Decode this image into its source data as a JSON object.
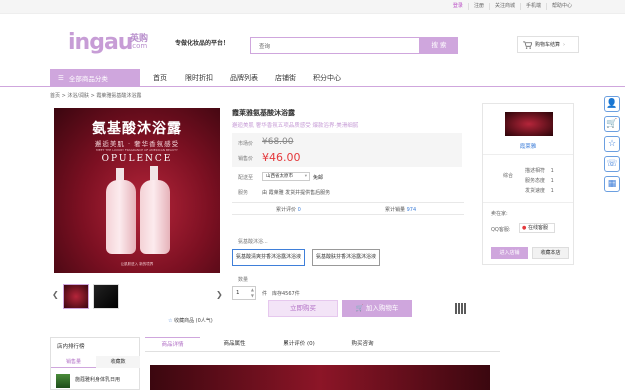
{
  "topbar": {
    "links": [
      "登录",
      "注册",
      "关注商城",
      "手机端",
      "帮助中心"
    ]
  },
  "header": {
    "logo": "ingau",
    "logo_cn": "英购",
    "logo_com": ".com",
    "slogan": "专做化妆品的平台！",
    "search_placeholder": "查询",
    "search_button": "搜 索",
    "cart_label": "购物车结算"
  },
  "nav": {
    "category_button": "全部商品分类",
    "items": [
      "首页",
      "限时折扣",
      "品牌列表",
      "店铺街",
      "积分中心"
    ]
  },
  "breadcrumb": "首页 > 沐浴/润肤 > 霞莱雅氨基酸沐浴露",
  "gallery": {
    "image_title": "氨基酸沐浴露",
    "image_tagline": "邂逅美肌 · 奢华香氛感受",
    "image_small": "MEET THE LUXURY FRAGRANCE OF AMERICAN BEAUTY",
    "image_brand": "OPULENCE",
    "image_footer": "让肌肤进入 新的境界",
    "favorite": "收藏商品 (0人气)"
  },
  "product": {
    "title": "霞莱雅氨基酸沐浴露",
    "subtitle": "邂逅美肌 奢华香氛五项品质感受 爆款浴界·美滑细腻",
    "orig_label": "市场价",
    "orig_price": "¥68.00",
    "sale_label": "销售价",
    "sale_price": "¥46.00",
    "ship_label": "配送至",
    "ship_region": "山西省太原市",
    "ship_fee": "免邮",
    "service_label": "服务",
    "service_text": "由 霞莱雅 发货并提供售后服务",
    "review_label": "累计评价",
    "review_count": "0",
    "sales_label": "累计销量",
    "sales_count": "974",
    "option_hint": "氨基酸沐浴...",
    "options": [
      "氨基酸清爽芬香沐浴露沐浴液",
      "氨基酸肤芬香沐浴露沐浴液"
    ],
    "qty_label": "数量",
    "qty_value": "1",
    "unit": "件",
    "stock": "库存4567件",
    "buy_now": "立即购买",
    "add_cart": "加入购物车"
  },
  "store": {
    "name": "霞莱雅",
    "score_label": "综合",
    "ratings": [
      {
        "label": "描述相符",
        "value": "1"
      },
      {
        "label": "服务态度",
        "value": "1"
      },
      {
        "label": "发货速度",
        "value": "1"
      }
    ],
    "seller_label": "卖在家:",
    "qq_label": "QQ客服:",
    "qq_button": "在线客服",
    "enter_store": "进入店铺",
    "collect_store": "收藏本店"
  },
  "rank": {
    "title": "店内排行榜",
    "tabs": [
      "销售量",
      "收藏数"
    ],
    "first_item": "施蔻雅利身体乳日用"
  },
  "tabs": [
    "商品详情",
    "商品属性",
    "累计评价 (0)",
    "购买咨询"
  ],
  "colors": {
    "accent": "#cfa6dd",
    "price": "#e4393c",
    "side_icon": "#3f7fd9"
  }
}
